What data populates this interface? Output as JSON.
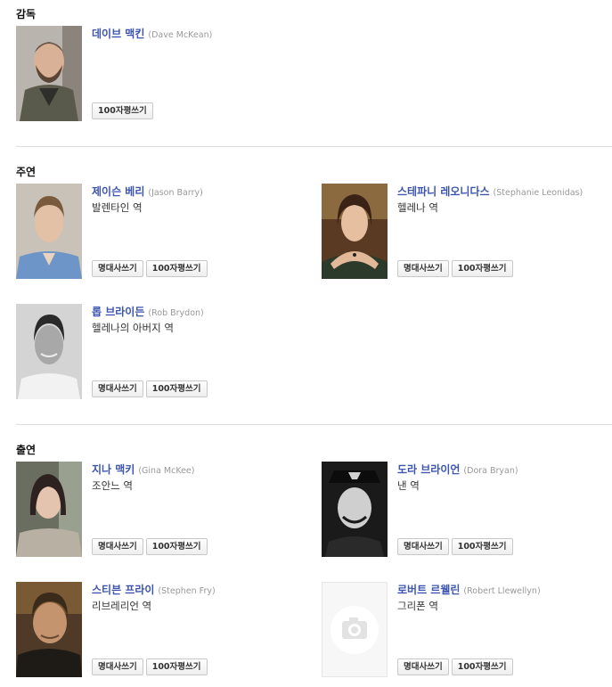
{
  "sections": {
    "director": {
      "title": "감독"
    },
    "lead": {
      "title": "주연"
    },
    "supporting": {
      "title": "출연"
    }
  },
  "people": {
    "dave": {
      "name_ko": "데이브 맥킨",
      "name_en": "(Dave McKean)",
      "buttons": [
        "100자평쓰기"
      ]
    },
    "jason": {
      "name_ko": "제이슨 베리",
      "name_en": "(Jason Barry)",
      "role": "발렌타인 역",
      "buttons": [
        "명대사쓰기",
        "100자평쓰기"
      ]
    },
    "stephanie": {
      "name_ko": "스테파니 레오니다스",
      "name_en": "(Stephanie Leonidas)",
      "role": "헬레나 역",
      "buttons": [
        "명대사쓰기",
        "100자평쓰기"
      ]
    },
    "rob": {
      "name_ko": "롭 브라이든",
      "name_en": "(Rob Brydon)",
      "role": "헬레나의 아버지 역",
      "buttons": [
        "명대사쓰기",
        "100자평쓰기"
      ]
    },
    "gina": {
      "name_ko": "지나 맥키",
      "name_en": "(Gina McKee)",
      "role": "조안느 역",
      "buttons": [
        "명대사쓰기",
        "100자평쓰기"
      ]
    },
    "dora": {
      "name_ko": "도라 브라이언",
      "name_en": "(Dora Bryan)",
      "role": "낸 역",
      "buttons": [
        "명대사쓰기",
        "100자평쓰기"
      ]
    },
    "stephen": {
      "name_ko": "스티븐 프라이",
      "name_en": "(Stephen Fry)",
      "role": "리브레리언 역",
      "buttons": [
        "명대사쓰기",
        "100자평쓰기"
      ]
    },
    "robert": {
      "name_ko": "로버트 르웰린",
      "name_en": "(Robert Llewellyn)",
      "role": "그리폰 역",
      "buttons": [
        "명대사쓰기",
        "100자평쓰기"
      ]
    }
  }
}
